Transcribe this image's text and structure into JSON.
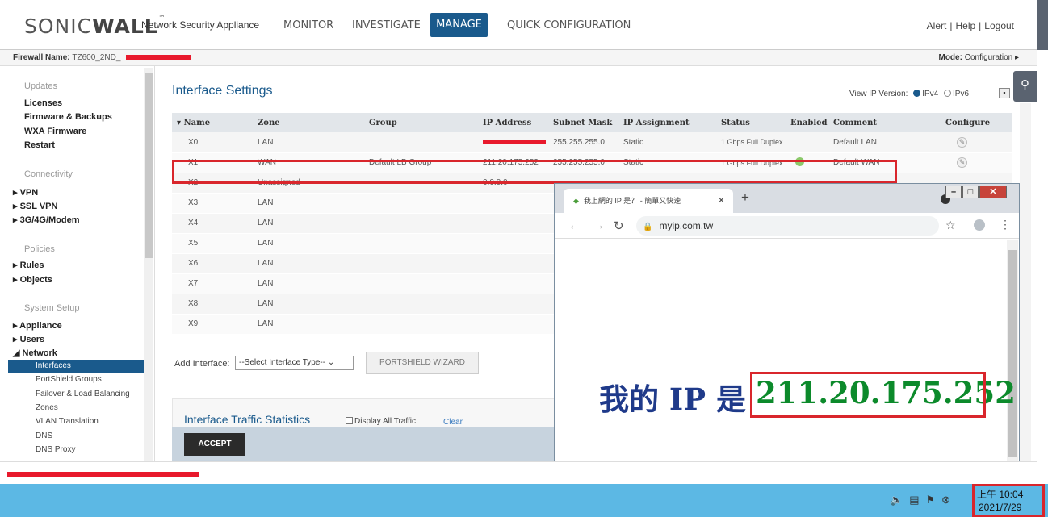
{
  "brand": {
    "name_light": "SONIC",
    "name_bold": "WALL",
    "product": "Network Security Appliance"
  },
  "nav": {
    "items": [
      "MONITOR",
      "INVESTIGATE",
      "MANAGE",
      "QUICK CONFIGURATION"
    ],
    "active": "MANAGE"
  },
  "top_links": [
    "Alert",
    "Help",
    "Logout"
  ],
  "firewall": {
    "label": "Firewall Name:",
    "value": "TZ600_2ND_"
  },
  "mode": {
    "label": "Mode:",
    "value": "Configuration ▸"
  },
  "sidebar": {
    "updates_header": "Updates",
    "updates_items": [
      "Licenses",
      "Firmware & Backups",
      "WXA Firmware",
      "Restart"
    ],
    "connectivity_header": "Connectivity",
    "connectivity_items": [
      "VPN",
      "SSL VPN",
      "3G/4G/Modem"
    ],
    "policies_header": "Policies",
    "policies_items": [
      "Rules",
      "Objects"
    ],
    "system_header": "System Setup",
    "system_items": [
      "Appliance",
      "Users",
      "Network"
    ],
    "network_subitems": [
      "Interfaces",
      "PortShield Groups",
      "Failover & Load Balancing",
      "Zones",
      "VLAN Translation",
      "DNS",
      "DNS Proxy"
    ]
  },
  "page": {
    "title": "Interface Settings",
    "ip_version_label": "View IP Version:",
    "ipv4": "IPv4",
    "ipv6": "IPv6"
  },
  "table": {
    "headers": [
      "Name",
      "Zone",
      "Group",
      "IP Address",
      "Subnet Mask",
      "IP Assignment",
      "Status",
      "Enabled",
      "Comment",
      "Configure"
    ],
    "rows": [
      {
        "name": "X0",
        "zone": "LAN",
        "group": "",
        "ip": "",
        "mask": "255.255.255.0",
        "assign": "Static",
        "status": "1 Gbps Full Duplex",
        "comment": "Default LAN"
      },
      {
        "name": "X1",
        "zone": "WAN",
        "group": "Default LB Group",
        "ip": "211.20.175.252",
        "mask": "255.255.255.0",
        "assign": "Static",
        "status": "1 Gbps Full Duplex",
        "comment": "Default WAN"
      },
      {
        "name": "X2",
        "zone": "Unassigned",
        "group": "",
        "ip": "0.0.0.0",
        "mask": "",
        "assign": "",
        "status": "",
        "comment": ""
      },
      {
        "name": "X3",
        "zone": "LAN"
      },
      {
        "name": "X4",
        "zone": "LAN"
      },
      {
        "name": "X5",
        "zone": "LAN"
      },
      {
        "name": "X6",
        "zone": "LAN"
      },
      {
        "name": "X7",
        "zone": "LAN"
      },
      {
        "name": "X8",
        "zone": "LAN"
      },
      {
        "name": "X9",
        "zone": "LAN"
      }
    ]
  },
  "add_interface": {
    "label": "Add Interface:",
    "select": "--Select Interface Type-- ⌄",
    "wizard": "PORTSHIELD WIZARD"
  },
  "traffic": {
    "title": "Interface Traffic Statistics",
    "display_all": "Display All Traffic",
    "clear": "Clear"
  },
  "accept": "ACCEPT",
  "browser": {
    "tab_title": "我上網的 IP 是？ - 簡單又快速",
    "url": "myip.com.tw",
    "myip_label": "我的 IP 是",
    "myip_value": "211.20.175.252"
  },
  "taskbar": {
    "time": "上午 10:04",
    "date": "2021/7/29"
  }
}
